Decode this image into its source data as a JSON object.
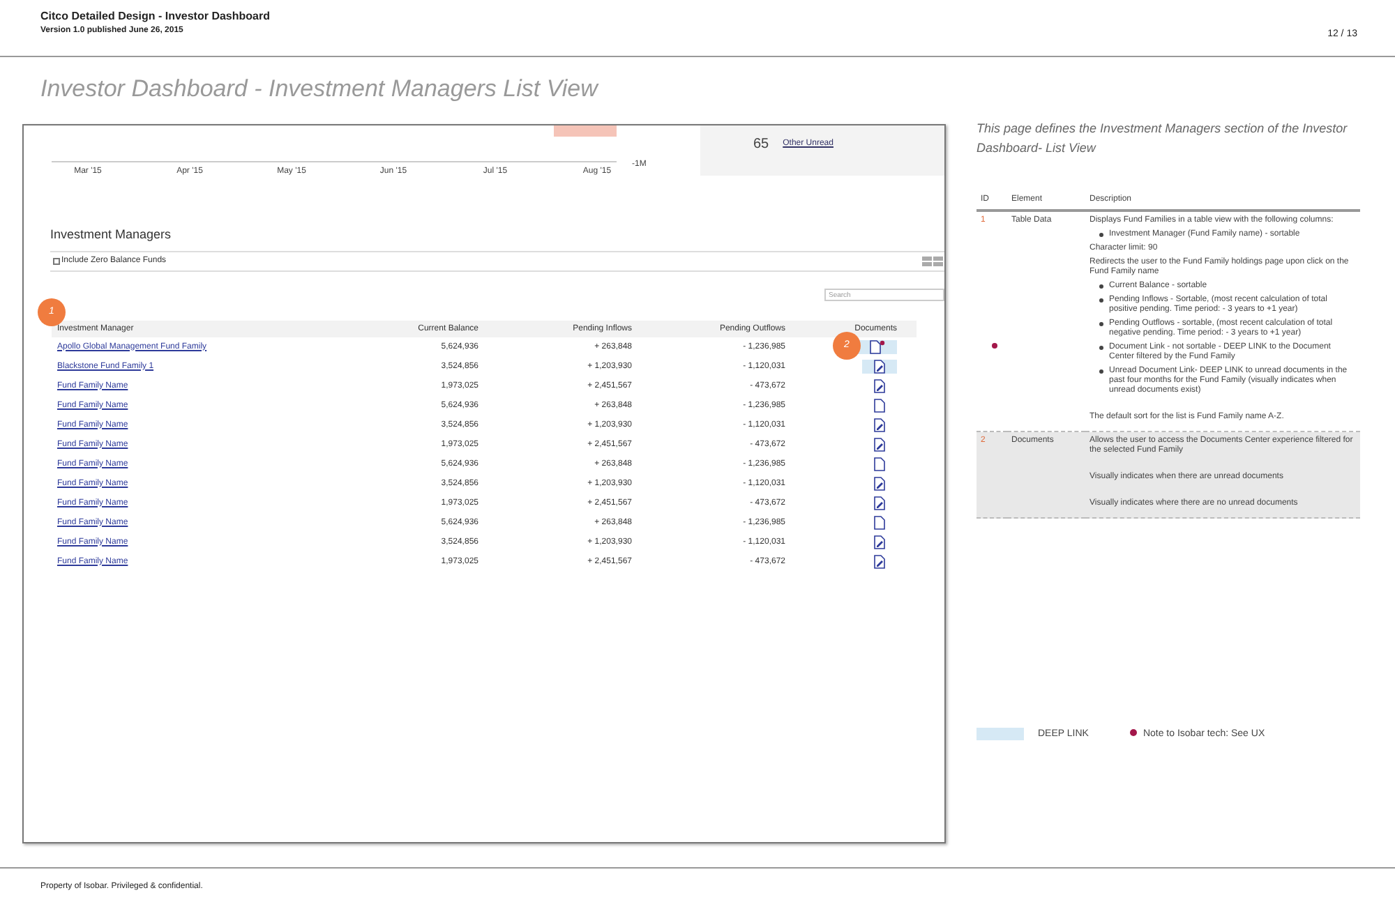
{
  "header": {
    "title": "Citco Detailed Design - Investor Dashboard",
    "version": "Version 1.0 published June 26, 2015",
    "page": "12 / 13"
  },
  "page_title": "Investor Dashboard - Investment Managers List View",
  "mockup": {
    "chart": {
      "months": [
        "Mar '15",
        "Apr '15",
        "May '15",
        "Jun '15",
        "Jul '15",
        "Aug '15"
      ],
      "axis_label": "-1M"
    },
    "unread": {
      "count": "65",
      "label": "Other Unread"
    },
    "heading": "Investment Managers",
    "filter": {
      "label": "Include Zero Balance Funds",
      "checked": false
    },
    "search": {
      "placeholder": "Search"
    },
    "callouts": [
      "1",
      "2"
    ],
    "columns": [
      "Investment Manager",
      "Current Balance",
      "Pending Inflows",
      "Pending Outflows",
      "Documents"
    ],
    "rows": [
      {
        "name": "Apollo Global Management Fund Family",
        "balance": "5,624,936",
        "inflow": "+ 263,848",
        "outflow": "- 1,236,985",
        "document": {
          "kind": "unread"
        },
        "deep_link": true
      },
      {
        "name": "Blackstone Fund Family 1",
        "balance": "3,524,856",
        "inflow": "+ 1,203,930",
        "outflow": "- 1,120,031",
        "document": {
          "kind": "updated"
        },
        "deep_link": true
      },
      {
        "name": "Fund Family Name",
        "balance": "1,973,025",
        "inflow": "+ 2,451,567",
        "outflow": "- 473,672",
        "document": {
          "kind": "updated"
        },
        "deep_link": false
      },
      {
        "name": "Fund Family Name",
        "balance": "5,624,936",
        "inflow": "+ 263,848",
        "outflow": "- 1,236,985",
        "document": {
          "kind": "blank"
        },
        "deep_link": false
      },
      {
        "name": "Fund Family Name",
        "balance": "3,524,856",
        "inflow": "+ 1,203,930",
        "outflow": "- 1,120,031",
        "document": {
          "kind": "updated"
        },
        "deep_link": false
      },
      {
        "name": "Fund Family Name",
        "balance": "1,973,025",
        "inflow": "+ 2,451,567",
        "outflow": "- 473,672",
        "document": {
          "kind": "updated"
        },
        "deep_link": false
      },
      {
        "name": "Fund Family Name",
        "balance": "5,624,936",
        "inflow": "+ 263,848",
        "outflow": "- 1,236,985",
        "document": {
          "kind": "blank"
        },
        "deep_link": false
      },
      {
        "name": "Fund Family Name",
        "balance": "3,524,856",
        "inflow": "+ 1,203,930",
        "outflow": "- 1,120,031",
        "document": {
          "kind": "updated"
        },
        "deep_link": false
      },
      {
        "name": "Fund Family Name",
        "balance": "1,973,025",
        "inflow": "+ 2,451,567",
        "outflow": "- 473,672",
        "document": {
          "kind": "updated"
        },
        "deep_link": false
      },
      {
        "name": "Fund Family Name",
        "balance": "5,624,936",
        "inflow": "+ 263,848",
        "outflow": "- 1,236,985",
        "document": {
          "kind": "blank"
        },
        "deep_link": false
      },
      {
        "name": "Fund Family Name",
        "balance": "3,524,856",
        "inflow": "+ 1,203,930",
        "outflow": "- 1,120,031",
        "document": {
          "kind": "updated"
        },
        "deep_link": false
      },
      {
        "name": "Fund Family Name",
        "balance": "1,973,025",
        "inflow": "+ 2,451,567",
        "outflow": "- 473,672",
        "document": {
          "kind": "updated"
        },
        "deep_link": false
      }
    ]
  },
  "spec": {
    "intro": "This page defines the Investment Managers section of the Investor Dashboard- List View",
    "columns": [
      "ID",
      "Element",
      "Description"
    ],
    "rows": [
      {
        "id": "1",
        "element": "Table Data",
        "note": true,
        "shaded": false,
        "description": [
          {
            "kind": "text",
            "text": "Displays Fund Families in a table view with the following columns:"
          },
          {
            "kind": "bullet",
            "text": "Investment Manager (Fund Family name) - sortable"
          },
          {
            "kind": "text",
            "text": "Character limit: 90"
          },
          {
            "kind": "text",
            "text": "Redirects the user to the Fund Family holdings page upon click on the Fund Family name"
          },
          {
            "kind": "bullet",
            "text": "Current Balance - sortable"
          },
          {
            "kind": "bullet",
            "text": "Pending Inflows - Sortable, (most recent calculation of total positive pending. Time period: - 3 years to +1 year)"
          },
          {
            "kind": "bullet",
            "text": "Pending Outflows - sortable, (most recent calculation of total negative pending. Time period: - 3 years to +1 year)"
          },
          {
            "kind": "bullet",
            "text": "Document Link - not sortable - DEEP LINK to the Document Center filtered by the Fund Family"
          },
          {
            "kind": "bullet",
            "text": "Unread Document Link- DEEP LINK to unread documents in the past four months for the Fund Family (visually indicates when unread documents exist)"
          },
          {
            "kind": "text",
            "text": "The default sort for the list is Fund Family name A-Z."
          }
        ]
      },
      {
        "id": "2",
        "element": "Documents",
        "note": false,
        "shaded": true,
        "description": [
          {
            "kind": "text",
            "text": "Allows the user to access the Documents Center experience filtered for the selected Fund Family"
          },
          {
            "kind": "text",
            "text": "Visually indicates when there are unread documents"
          },
          {
            "kind": "text",
            "text": "Visually indicates where there are no unread documents"
          }
        ]
      }
    ]
  },
  "legend": {
    "deep_link": "DEEP LINK",
    "note": "Note to Isobar tech: See UX"
  },
  "footer": "Property of Isobar. Privileged & confidential."
}
